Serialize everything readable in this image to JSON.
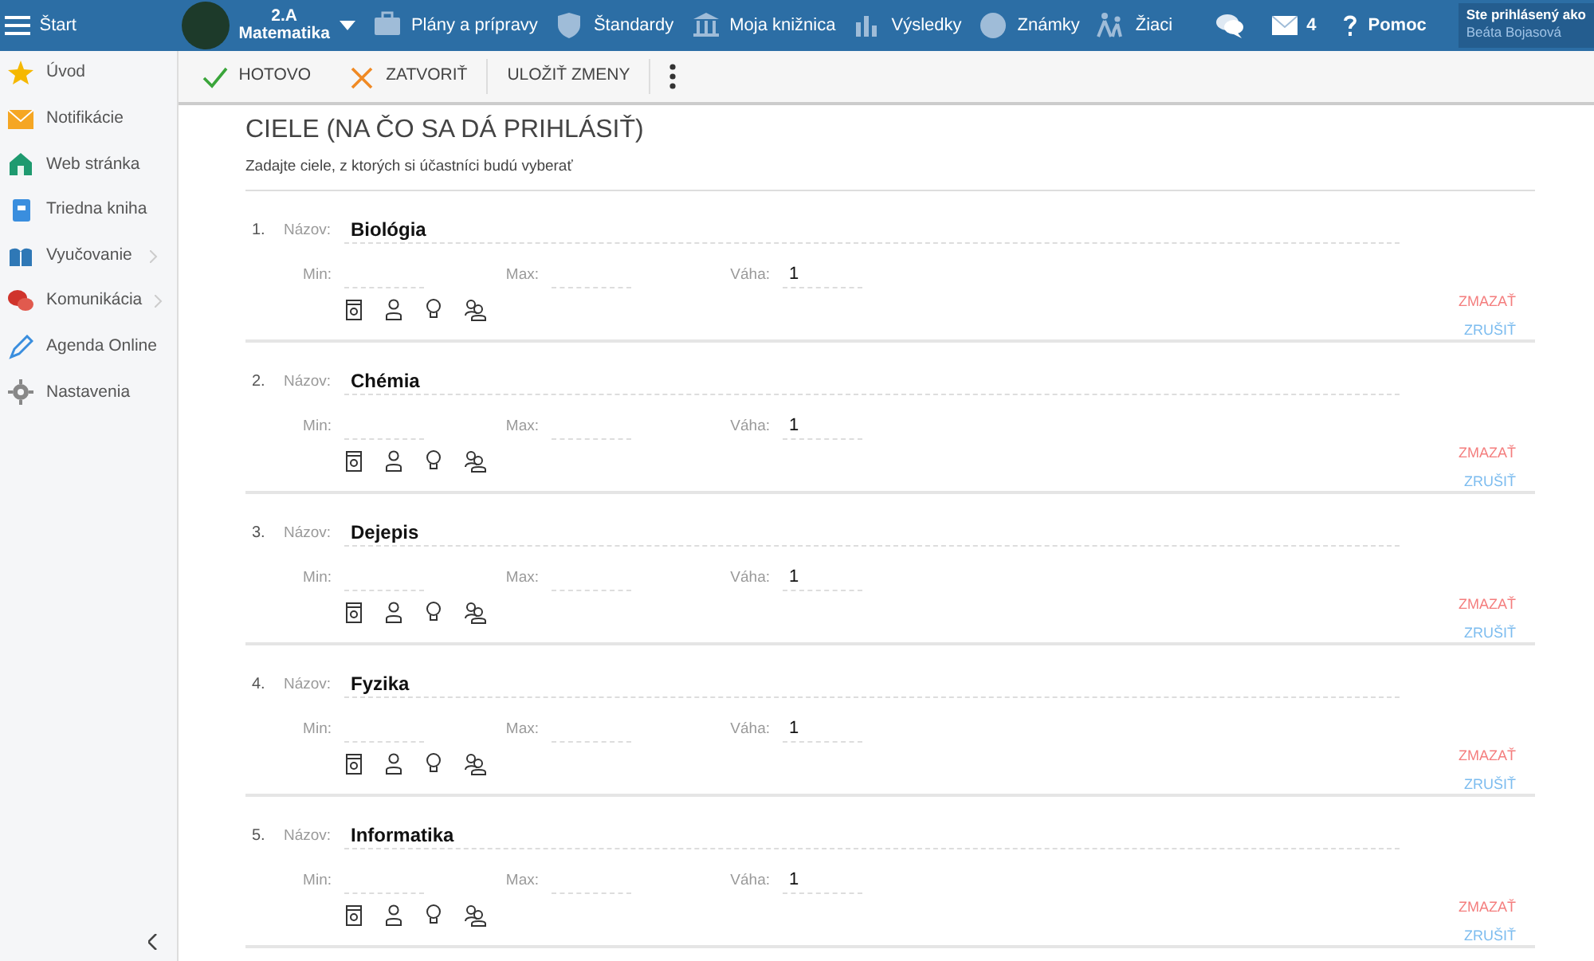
{
  "topbar": {
    "menu_label": "Štart",
    "class": {
      "line1": "2.A",
      "line2": "Matematika"
    },
    "nav": [
      {
        "label": "Plány a prípravy"
      },
      {
        "label": "Štandardy"
      },
      {
        "label": "Moja knižnica"
      },
      {
        "label": "Výsledky"
      },
      {
        "label": "Známky"
      },
      {
        "label": "Žiaci"
      }
    ],
    "messages_count": "4",
    "help": "Pomoc",
    "user": {
      "caption": "Ste prihlásený ako",
      "name": "Beáta Bojasová"
    }
  },
  "sidebar": {
    "items": [
      {
        "label": "Úvod",
        "expandable": false
      },
      {
        "label": "Notifikácie",
        "expandable": false
      },
      {
        "label": "Web stránka",
        "expandable": false
      },
      {
        "label": "Triedna kniha",
        "expandable": false
      },
      {
        "label": "Vyučovanie",
        "expandable": true
      },
      {
        "label": "Komunikácia",
        "expandable": true
      },
      {
        "label": "Agenda Online",
        "expandable": false
      },
      {
        "label": "Nastavenia",
        "expandable": false
      }
    ]
  },
  "toolbar": [
    {
      "kind": "done",
      "label": "HOTOVO"
    },
    {
      "kind": "close",
      "label": "ZATVORIŤ"
    },
    {
      "kind": "save",
      "label": "ULOŽIŤ ZMENY"
    }
  ],
  "title": "CIELE (NA ČO SA DÁ PRIHLÁSIŤ)",
  "subtitle": "Zadajte ciele, z ktorých si účastníci budú vyberať",
  "goals": [
    {
      "number": "1.",
      "name_label": "Názov:",
      "name": "Biológia",
      "min_label": "Min:",
      "max_label": "Max:",
      "weight_label": "Váha:",
      "weight": "1",
      "delete": "ZMAZAŤ",
      "cancel": "ZRUŠIŤ"
    },
    {
      "number": "2.",
      "name_label": "Názov:",
      "name": "Chémia",
      "min_label": "Min:",
      "max_label": "Max:",
      "weight_label": "Váha:",
      "weight": "1",
      "delete": "ZMAZAŤ",
      "cancel": "ZRUŠIŤ"
    },
    {
      "number": "3.",
      "name_label": "Názov:",
      "name": "Dejepis",
      "min_label": "Min:",
      "max_label": "Max:",
      "weight_label": "Váha:",
      "weight": "1",
      "delete": "ZMAZAŤ",
      "cancel": "ZRUŠIŤ"
    },
    {
      "number": "4.",
      "name_label": "Názov:",
      "name": "Fyzika",
      "min_label": "Min:",
      "max_label": "Max:",
      "weight_label": "Váha:",
      "weight": "1",
      "delete": "ZMAZAŤ",
      "cancel": "ZRUŠIŤ"
    },
    {
      "number": "5.",
      "name_label": "Názov:",
      "name": "Informatika",
      "min_label": "Min:",
      "max_label": "Max:",
      "weight_label": "Váha:",
      "weight": "1",
      "delete": "ZMAZAŤ",
      "cancel": "ZRUŠIŤ"
    }
  ]
}
